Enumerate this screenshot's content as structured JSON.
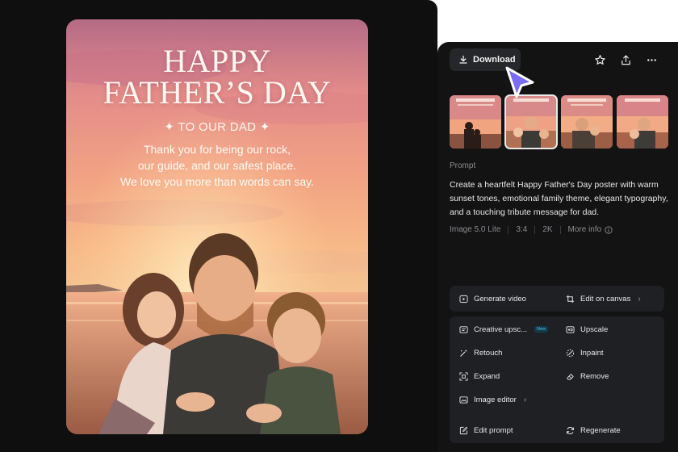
{
  "poster": {
    "title_line1": "HAPPY",
    "title_line2": "FATHER’S DAY",
    "subtitle": "✦ TO OUR DAD ✦",
    "message_lines": [
      "Thank you for being our rock,",
      "our guide, and our safest place.",
      "We love you more than words can say."
    ]
  },
  "toolbar": {
    "download_label": "Download",
    "icons": [
      "download-icon",
      "star-icon",
      "share-icon",
      "more-icon"
    ]
  },
  "thumbnails": {
    "count": 4,
    "selected_index": 1
  },
  "prompt": {
    "label": "Prompt",
    "text": "Create a heartfelt Happy Father's Day poster with warm sunset tones, emotional family theme, elegant typography, and a touching tribute message for dad."
  },
  "meta": {
    "model": "Image 5.0 Lite",
    "ratio": "3:4",
    "resolution": "2K",
    "more_info": "More info"
  },
  "actions": {
    "generate_video": "Generate video",
    "edit_on_canvas": "Edit on canvas",
    "creative_upscale": "Creative upsc...",
    "new_badge": "New",
    "upscale": "Upscale",
    "retouch": "Retouch",
    "inpaint": "Inpaint",
    "expand": "Expand",
    "remove": "Remove",
    "image_editor": "Image editor",
    "edit_prompt": "Edit prompt",
    "regenerate": "Regenerate",
    "chevron": "›"
  },
  "colors": {
    "canvas_bg": "#0f0f10",
    "panel_bg": "#131314",
    "card_bg": "#1f2023",
    "cursor_accent": "#7b6cf6",
    "new_badge": "#4fc3e6"
  }
}
